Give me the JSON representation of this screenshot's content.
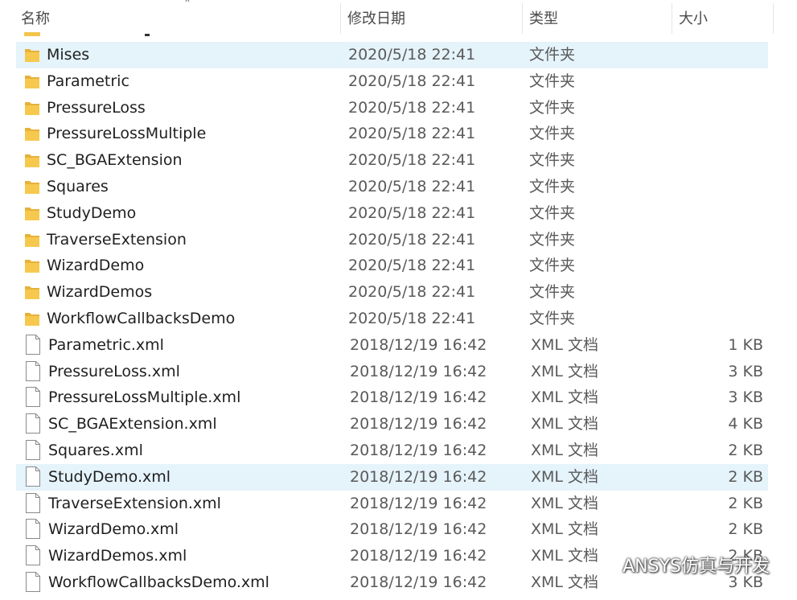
{
  "columns": {
    "name": "名称",
    "modified": "修改日期",
    "type": "类型",
    "size": "大小"
  },
  "folders": [
    {
      "name": "Mises",
      "date": "2020/5/18 22:41",
      "type": "文件夹",
      "selected": true
    },
    {
      "name": "Parametric",
      "date": "2020/5/18 22:41",
      "type": "文件夹"
    },
    {
      "name": "PressureLoss",
      "date": "2020/5/18 22:41",
      "type": "文件夹"
    },
    {
      "name": "PressureLossMultiple",
      "date": "2020/5/18 22:41",
      "type": "文件夹"
    },
    {
      "name": "SC_BGAExtension",
      "date": "2020/5/18 22:41",
      "type": "文件夹"
    },
    {
      "name": "Squares",
      "date": "2020/5/18 22:41",
      "type": "文件夹"
    },
    {
      "name": "StudyDemo",
      "date": "2020/5/18 22:41",
      "type": "文件夹"
    },
    {
      "name": "TraverseExtension",
      "date": "2020/5/18 22:41",
      "type": "文件夹"
    },
    {
      "name": "WizardDemo",
      "date": "2020/5/18 22:41",
      "type": "文件夹"
    },
    {
      "name": "WizardDemos",
      "date": "2020/5/18 22:41",
      "type": "文件夹"
    },
    {
      "name": "WorkflowCallbacksDemo",
      "date": "2020/5/18 22:41",
      "type": "文件夹"
    }
  ],
  "files": [
    {
      "name": "Parametric.xml",
      "date": "2018/12/19 16:42",
      "type": "XML 文档",
      "size": "1 KB"
    },
    {
      "name": "PressureLoss.xml",
      "date": "2018/12/19 16:42",
      "type": "XML 文档",
      "size": "3 KB"
    },
    {
      "name": "PressureLossMultiple.xml",
      "date": "2018/12/19 16:42",
      "type": "XML 文档",
      "size": "3 KB"
    },
    {
      "name": "SC_BGAExtension.xml",
      "date": "2018/12/19 16:42",
      "type": "XML 文档",
      "size": "4 KB"
    },
    {
      "name": "Squares.xml",
      "date": "2018/12/19 16:42",
      "type": "XML 文档",
      "size": "2 KB"
    },
    {
      "name": "StudyDemo.xml",
      "date": "2018/12/19 16:42",
      "type": "XML 文档",
      "size": "2 KB",
      "selected": true
    },
    {
      "name": "TraverseExtension.xml",
      "date": "2018/12/19 16:42",
      "type": "XML 文档",
      "size": "2 KB"
    },
    {
      "name": "WizardDemo.xml",
      "date": "2018/12/19 16:42",
      "type": "XML 文档",
      "size": "2 KB"
    },
    {
      "name": "WizardDemos.xml",
      "date": "2018/12/19 16:42",
      "type": "XML 文档",
      "size": "2 KB"
    },
    {
      "name": "WorkflowCallbacksDemo.xml",
      "date": "2018/12/19 16:42",
      "type": "XML 文档",
      "size": "3 KB"
    }
  ],
  "watermark": {
    "text": "ANSYS仿真与开发",
    "icon": "wechat-icon"
  },
  "colors": {
    "selection": "#e5f3fb",
    "folder": "#f6c94e",
    "folder_dark": "#e6b23a"
  }
}
